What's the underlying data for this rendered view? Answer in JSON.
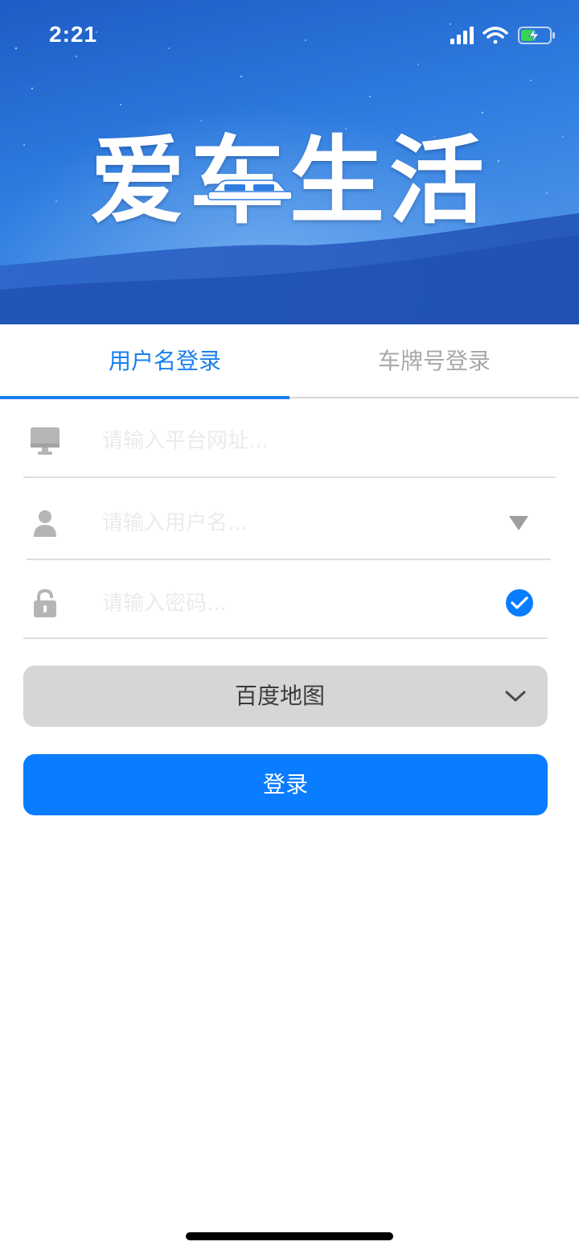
{
  "status_bar": {
    "time": "2:21",
    "icons": [
      "cellular-signal-icon",
      "wifi-icon",
      "battery-charging-icon"
    ]
  },
  "header": {
    "title": "爱车生活"
  },
  "tabs": [
    {
      "label": "用户名登录",
      "active": true
    },
    {
      "label": "车牌号登录",
      "active": false
    }
  ],
  "form": {
    "platform": {
      "placeholder": "请输入平台网址...",
      "value": "",
      "icon": "monitor-icon"
    },
    "username": {
      "placeholder": "请输入用户名...",
      "value": "",
      "icon": "user-icon",
      "trailing_icon": "dropdown-triangle-icon"
    },
    "password": {
      "placeholder": "请输入密码...",
      "value": "",
      "icon": "lock-icon",
      "trailing_icon": "check-circle-icon"
    }
  },
  "map_select": {
    "selected": "百度地图"
  },
  "login_button": {
    "label": "登录"
  },
  "colors": {
    "accent": "#0a7cff",
    "tab_active": "#1a7ff0",
    "tab_inactive": "#a9a9a9",
    "select_bg": "#d6d6d6"
  }
}
